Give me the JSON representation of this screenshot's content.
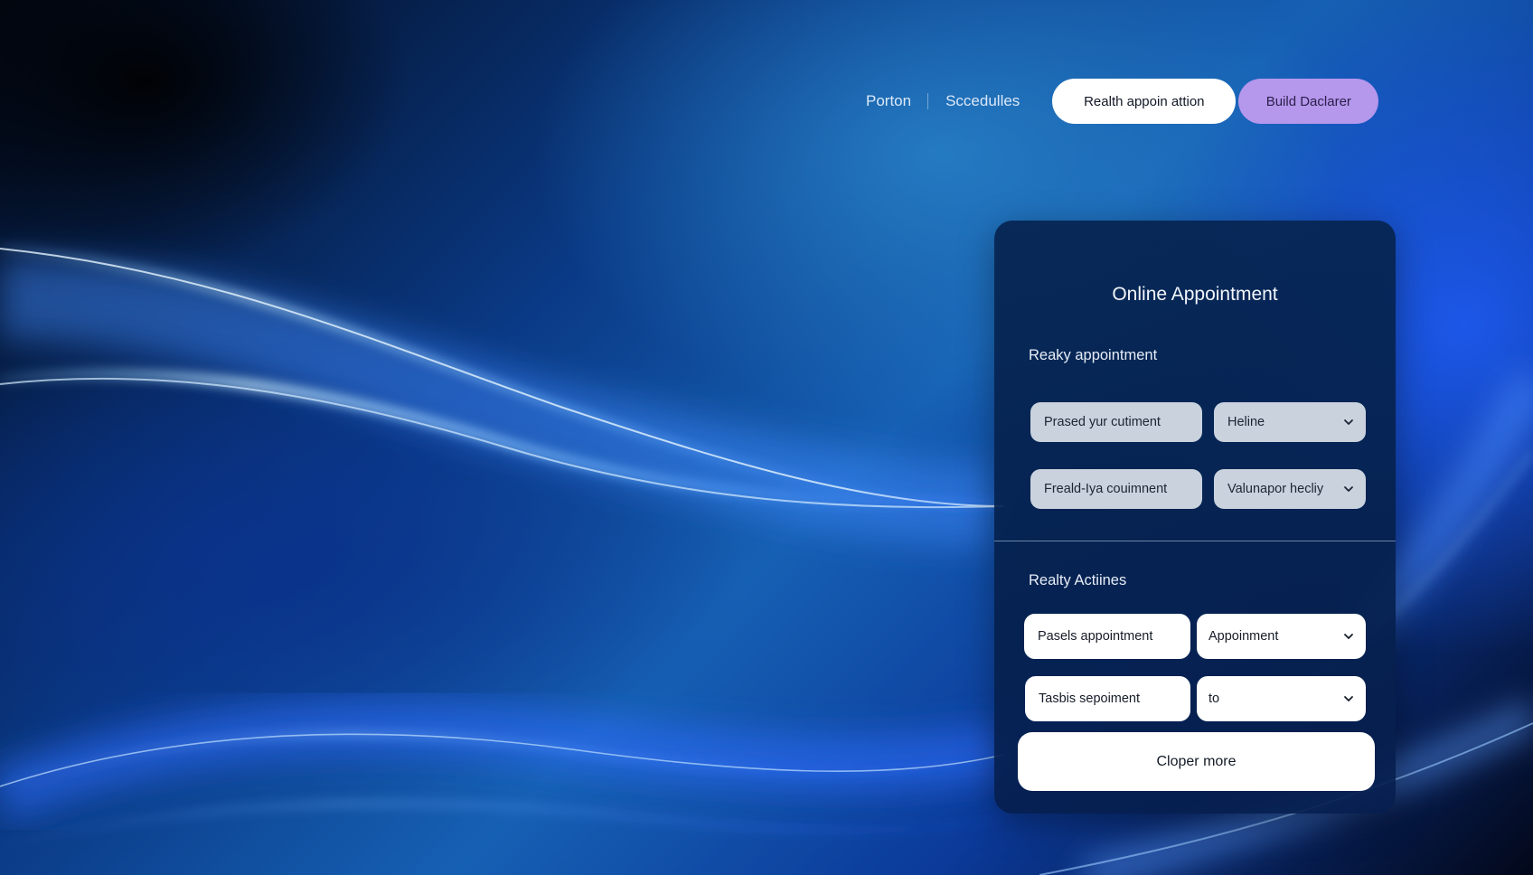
{
  "nav": {
    "link_1": "Porton",
    "link_2": "Sccedulles",
    "button_primary": "Realth appoin attion",
    "button_secondary": "Build Daclarer"
  },
  "panel": {
    "title": "Online Appointment",
    "section_1": {
      "label": "Reaky appointment",
      "fields": [
        {
          "value": "Prased yur cutiment",
          "type": "text"
        },
        {
          "value": "Heline",
          "type": "select"
        },
        {
          "value": "Freald-Iya couimnent",
          "type": "text"
        },
        {
          "value": "Valunapor hecliy",
          "type": "select"
        }
      ]
    },
    "section_2": {
      "label": "Realty Actiines",
      "fields": [
        {
          "value": "Pasels appointment",
          "type": "text"
        },
        {
          "value": "Appoinment",
          "type": "select"
        },
        {
          "value": "Tasbis sepoiment",
          "type": "text"
        },
        {
          "value": "to",
          "type": "select"
        }
      ]
    },
    "cta_label": "Cloper more"
  },
  "colors": {
    "accent_lilac": "#b597ec",
    "panel_bg": "#052450",
    "field_grey": "#c9d2dd"
  },
  "icons": {
    "dropdown": "chevron-down-icon"
  }
}
